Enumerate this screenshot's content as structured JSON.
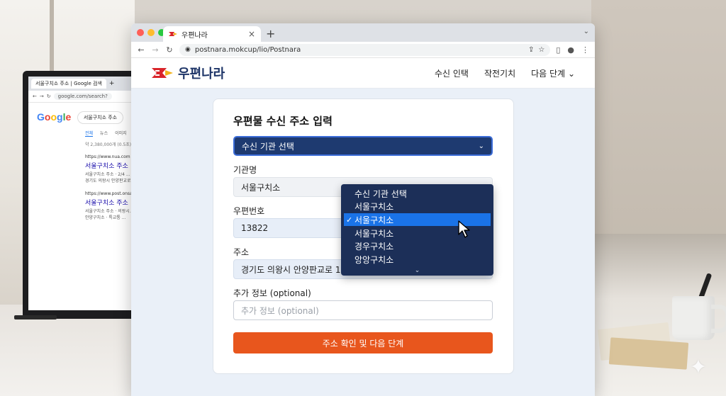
{
  "left_monitor": {
    "tab_title": "서울구치소 주소 | Google 검색",
    "url": "google.com/search?",
    "google_logo": "Google",
    "search_query": "서울구치소 주소",
    "tabs": [
      "전체",
      "뉴스",
      "이미지"
    ],
    "result_stats": "약 2,380,000개 (0.5초)",
    "results": [
      {
        "url": "https://www.nua.com",
        "title": "서울구치소 주소",
        "desc1": "서울구치소 주소 · 2/4 ...",
        "desc2": "경기도 의왕시 안양판교로"
      },
      {
        "url": "https://www.post.onsa",
        "title": "서울구치소 주소",
        "desc1": "서울구치소 주소 · 의왕시...",
        "desc2": "안양구치소 · 특교통 ..."
      }
    ]
  },
  "browser": {
    "tab_title": "우편나라",
    "url": "postnara.mokcup/lio/Postnara",
    "traffic_colors": [
      "#ff5f57",
      "#febc2e",
      "#28c840"
    ]
  },
  "site": {
    "brand": "우편나라",
    "brand_color": "#1e3568",
    "nav": [
      "수신 인택",
      "작전기치",
      "다음 단계"
    ],
    "nav_chevron": "⌄"
  },
  "form": {
    "title": "우편물 수신 주소 입력",
    "select_value": "수신 기관 선택",
    "select_chevron": "⌄",
    "org_label": "기관명",
    "org_value": "서울구치소",
    "postal_label": "우편번호",
    "postal_value": "13822",
    "address_label": "주소",
    "address_value": "경기도 의왕시 안양판교로 143",
    "extra_label": "추가 정보 (optional)",
    "extra_placeholder": "추가 정보 (optional)",
    "submit_label": "주소 확인 및 다음 단계",
    "submit_color": "#e8561d",
    "select_color": "#1e3a70"
  },
  "dropdown": {
    "options": [
      "수신 기관 선택",
      "서울구치소",
      "서울구치소",
      "서울구치소",
      "경우구치소",
      "앙앙구치소"
    ],
    "selected_index": 2,
    "check": "✓",
    "more": "⌄"
  },
  "icons": {
    "back": "arrow-left-icon",
    "forward": "arrow-right-icon",
    "reload": "reload-icon",
    "lock": "lock-icon",
    "share": "share-icon",
    "bookmark": "star-icon",
    "sidebar": "sidebar-icon",
    "profile": "profile-icon",
    "menu": "kebab-menu-icon"
  }
}
